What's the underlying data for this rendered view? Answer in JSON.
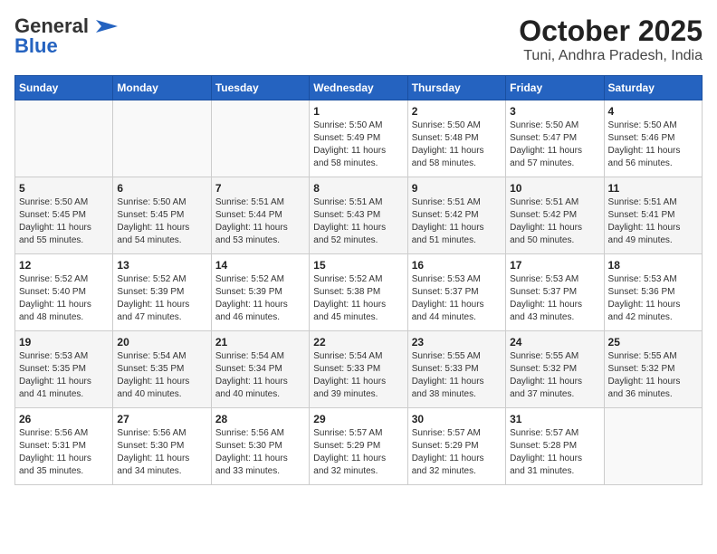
{
  "header": {
    "logo_general": "General",
    "logo_blue": "Blue",
    "title": "October 2025",
    "subtitle": "Tuni, Andhra Pradesh, India"
  },
  "days_of_week": [
    "Sunday",
    "Monday",
    "Tuesday",
    "Wednesday",
    "Thursday",
    "Friday",
    "Saturday"
  ],
  "weeks": [
    [
      {
        "day": "",
        "content": ""
      },
      {
        "day": "",
        "content": ""
      },
      {
        "day": "",
        "content": ""
      },
      {
        "day": "1",
        "content": "Sunrise: 5:50 AM\nSunset: 5:49 PM\nDaylight: 11 hours\nand 58 minutes."
      },
      {
        "day": "2",
        "content": "Sunrise: 5:50 AM\nSunset: 5:48 PM\nDaylight: 11 hours\nand 58 minutes."
      },
      {
        "day": "3",
        "content": "Sunrise: 5:50 AM\nSunset: 5:47 PM\nDaylight: 11 hours\nand 57 minutes."
      },
      {
        "day": "4",
        "content": "Sunrise: 5:50 AM\nSunset: 5:46 PM\nDaylight: 11 hours\nand 56 minutes."
      }
    ],
    [
      {
        "day": "5",
        "content": "Sunrise: 5:50 AM\nSunset: 5:45 PM\nDaylight: 11 hours\nand 55 minutes."
      },
      {
        "day": "6",
        "content": "Sunrise: 5:50 AM\nSunset: 5:45 PM\nDaylight: 11 hours\nand 54 minutes."
      },
      {
        "day": "7",
        "content": "Sunrise: 5:51 AM\nSunset: 5:44 PM\nDaylight: 11 hours\nand 53 minutes."
      },
      {
        "day": "8",
        "content": "Sunrise: 5:51 AM\nSunset: 5:43 PM\nDaylight: 11 hours\nand 52 minutes."
      },
      {
        "day": "9",
        "content": "Sunrise: 5:51 AM\nSunset: 5:42 PM\nDaylight: 11 hours\nand 51 minutes."
      },
      {
        "day": "10",
        "content": "Sunrise: 5:51 AM\nSunset: 5:42 PM\nDaylight: 11 hours\nand 50 minutes."
      },
      {
        "day": "11",
        "content": "Sunrise: 5:51 AM\nSunset: 5:41 PM\nDaylight: 11 hours\nand 49 minutes."
      }
    ],
    [
      {
        "day": "12",
        "content": "Sunrise: 5:52 AM\nSunset: 5:40 PM\nDaylight: 11 hours\nand 48 minutes."
      },
      {
        "day": "13",
        "content": "Sunrise: 5:52 AM\nSunset: 5:39 PM\nDaylight: 11 hours\nand 47 minutes."
      },
      {
        "day": "14",
        "content": "Sunrise: 5:52 AM\nSunset: 5:39 PM\nDaylight: 11 hours\nand 46 minutes."
      },
      {
        "day": "15",
        "content": "Sunrise: 5:52 AM\nSunset: 5:38 PM\nDaylight: 11 hours\nand 45 minutes."
      },
      {
        "day": "16",
        "content": "Sunrise: 5:53 AM\nSunset: 5:37 PM\nDaylight: 11 hours\nand 44 minutes."
      },
      {
        "day": "17",
        "content": "Sunrise: 5:53 AM\nSunset: 5:37 PM\nDaylight: 11 hours\nand 43 minutes."
      },
      {
        "day": "18",
        "content": "Sunrise: 5:53 AM\nSunset: 5:36 PM\nDaylight: 11 hours\nand 42 minutes."
      }
    ],
    [
      {
        "day": "19",
        "content": "Sunrise: 5:53 AM\nSunset: 5:35 PM\nDaylight: 11 hours\nand 41 minutes."
      },
      {
        "day": "20",
        "content": "Sunrise: 5:54 AM\nSunset: 5:35 PM\nDaylight: 11 hours\nand 40 minutes."
      },
      {
        "day": "21",
        "content": "Sunrise: 5:54 AM\nSunset: 5:34 PM\nDaylight: 11 hours\nand 40 minutes."
      },
      {
        "day": "22",
        "content": "Sunrise: 5:54 AM\nSunset: 5:33 PM\nDaylight: 11 hours\nand 39 minutes."
      },
      {
        "day": "23",
        "content": "Sunrise: 5:55 AM\nSunset: 5:33 PM\nDaylight: 11 hours\nand 38 minutes."
      },
      {
        "day": "24",
        "content": "Sunrise: 5:55 AM\nSunset: 5:32 PM\nDaylight: 11 hours\nand 37 minutes."
      },
      {
        "day": "25",
        "content": "Sunrise: 5:55 AM\nSunset: 5:32 PM\nDaylight: 11 hours\nand 36 minutes."
      }
    ],
    [
      {
        "day": "26",
        "content": "Sunrise: 5:56 AM\nSunset: 5:31 PM\nDaylight: 11 hours\nand 35 minutes."
      },
      {
        "day": "27",
        "content": "Sunrise: 5:56 AM\nSunset: 5:30 PM\nDaylight: 11 hours\nand 34 minutes."
      },
      {
        "day": "28",
        "content": "Sunrise: 5:56 AM\nSunset: 5:30 PM\nDaylight: 11 hours\nand 33 minutes."
      },
      {
        "day": "29",
        "content": "Sunrise: 5:57 AM\nSunset: 5:29 PM\nDaylight: 11 hours\nand 32 minutes."
      },
      {
        "day": "30",
        "content": "Sunrise: 5:57 AM\nSunset: 5:29 PM\nDaylight: 11 hours\nand 32 minutes."
      },
      {
        "day": "31",
        "content": "Sunrise: 5:57 AM\nSunset: 5:28 PM\nDaylight: 11 hours\nand 31 minutes."
      },
      {
        "day": "",
        "content": ""
      }
    ]
  ]
}
